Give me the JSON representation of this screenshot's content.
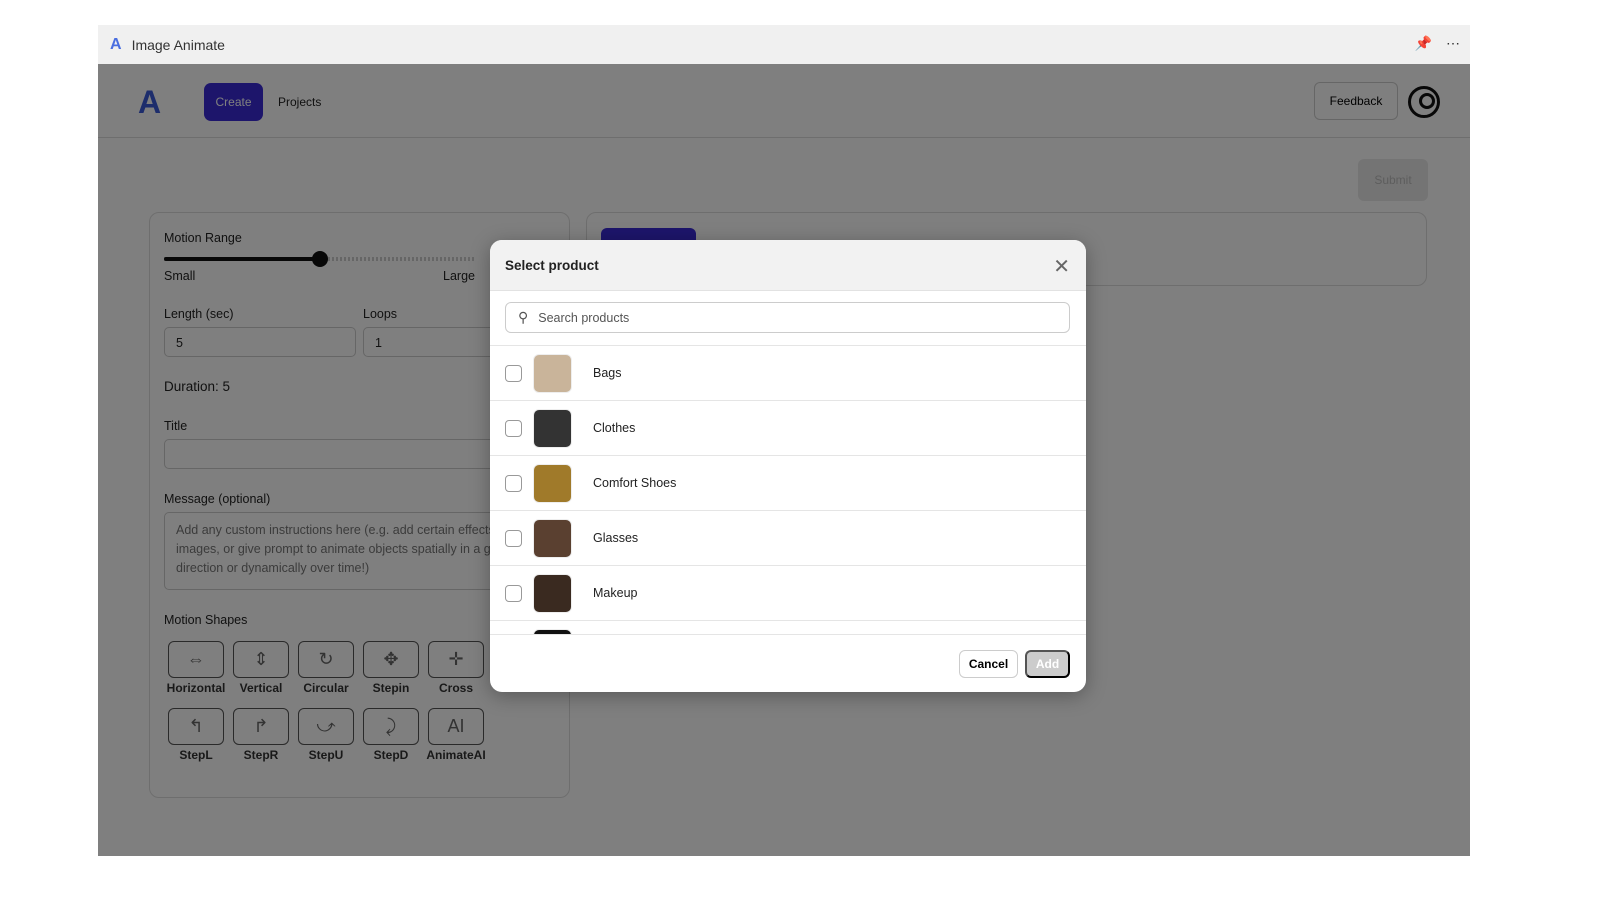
{
  "window": {
    "title": "Image Animate",
    "pin_icon": "pin-icon",
    "more_icon": "more-icon"
  },
  "nav": {
    "create": "Create",
    "projects": "Projects",
    "feedback": "Feedback"
  },
  "toolbar": {
    "submit": "Submit"
  },
  "form": {
    "motion_range": {
      "label": "Motion Range",
      "min_label": "Small",
      "max_label": "Large",
      "value": 0.5
    },
    "length": {
      "label": "Length (sec)",
      "value": "5"
    },
    "loops": {
      "label": "Loops",
      "value": "1"
    },
    "duration": "Duration: 5",
    "title": {
      "label": "Title",
      "value": ""
    },
    "message": {
      "label": "Message (optional)",
      "placeholder": "Add any custom instructions here (e.g. add certain effects to images, or give prompt to animate objects spatially in a given direction or dynamically over time!)"
    },
    "motion_shapes": {
      "label": "Motion Shapes",
      "items": [
        {
          "name": "Horizontal",
          "glyph": "⇔"
        },
        {
          "name": "Vertical",
          "glyph": "⇕"
        },
        {
          "name": "Circular",
          "glyph": "↻"
        },
        {
          "name": "Stepin",
          "glyph": "✥"
        },
        {
          "name": "Cross",
          "glyph": "✛"
        },
        {
          "name": "StepL",
          "glyph": "↰"
        },
        {
          "name": "StepR",
          "glyph": "↱"
        },
        {
          "name": "StepU",
          "glyph": "⤻"
        },
        {
          "name": "StepD",
          "glyph": "⤸"
        },
        {
          "name": "AnimateAI",
          "glyph": "AI"
        }
      ]
    }
  },
  "modal": {
    "title": "Select product",
    "search_placeholder": "Search products",
    "items": [
      {
        "label": "Bags",
        "color": "#c9b49a"
      },
      {
        "label": "Clothes",
        "color": "#333333"
      },
      {
        "label": "Comfort Shoes",
        "color": "#a07a2a"
      },
      {
        "label": "Glasses",
        "color": "#5a4030"
      },
      {
        "label": "Makeup",
        "color": "#3a2a20"
      },
      {
        "label": "",
        "color": "#111111"
      }
    ],
    "cancel": "Cancel",
    "add": "Add"
  },
  "colors": {
    "accent": "#3a2ad6"
  }
}
